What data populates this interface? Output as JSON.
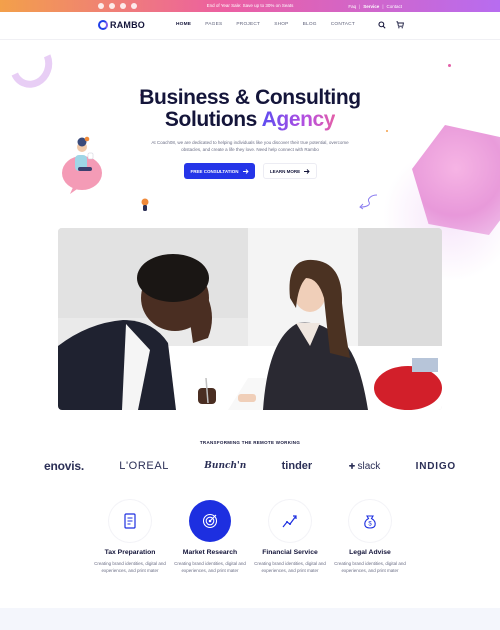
{
  "topbar": {
    "promo": "End of Year Sale: Save up to 30% on Seats",
    "links": [
      "Faq",
      "Service",
      "Contact"
    ],
    "separator": "|"
  },
  "brand": {
    "name": "RAMBO"
  },
  "nav": {
    "items": [
      "HOME",
      "PAGES",
      "PROJECT",
      "SHOP",
      "BLOG",
      "CONTACT"
    ]
  },
  "hero": {
    "title_line1": "Business & Consulting",
    "title_line2_plain": "Solutions ",
    "title_line2_accent": "Agency",
    "description": "At Coach08, we are dedicated to helping individuals like you discover their true potential, overcome obstacles, and create a life they love. Need help connect with Rambo",
    "primary_button": "FREE CONSULTATION",
    "secondary_button": "LEARN MORE"
  },
  "partners": {
    "title": "TRANSFORMING THE REMOTE WORKING",
    "logos": [
      "enovis.",
      "L'OREAL",
      "Bunch'n",
      "tinder",
      "slack",
      "INDIGO"
    ]
  },
  "services": [
    {
      "title": "Tax Preparation",
      "desc": "Creating brand identities, digital and experiences, and print mater",
      "icon": "document-icon"
    },
    {
      "title": "Market Research",
      "desc": "Creating brand identities, digital and experiences, and print mater",
      "icon": "target-icon"
    },
    {
      "title": "Financial Service",
      "desc": "Creating brand identities, digital and experiences, and print mater",
      "icon": "chart-icon"
    },
    {
      "title": "Legal Advise",
      "desc": "Creating brand identities, digital and experiences, and print mater",
      "icon": "money-bag-icon"
    }
  ],
  "colors": {
    "primary": "#2535e8",
    "dark": "#14153a",
    "accent_pink": "#e35fa8"
  }
}
